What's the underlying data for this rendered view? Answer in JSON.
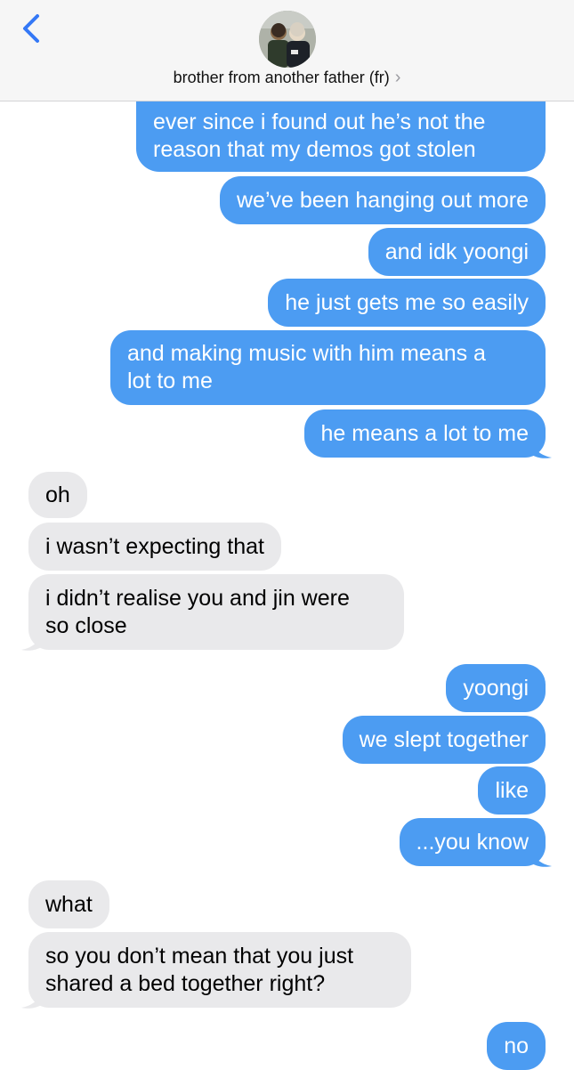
{
  "header": {
    "contact_name": "brother from another father (fr)",
    "chevron": "›",
    "back_icon": "chevron-left-icon",
    "avatar": "contact-avatar-photo"
  },
  "colors": {
    "sent_bubble": "#4c9cf2",
    "received_bubble": "#e9e9eb",
    "ios_blue": "#3478f6"
  },
  "messages": [
    {
      "from": "me",
      "lines": [
        "ever since i found out he’s not the",
        "reason that my demos got stolen"
      ]
    },
    {
      "from": "me",
      "lines": [
        "we’ve been hanging out more"
      ]
    },
    {
      "from": "me",
      "lines": [
        "and idk yoongi"
      ]
    },
    {
      "from": "me",
      "lines": [
        "he just gets me so easily"
      ]
    },
    {
      "from": "me",
      "lines": [
        "and making music with him means a",
        "lot to me"
      ]
    },
    {
      "from": "me",
      "lines": [
        "he means a lot to me"
      ]
    },
    {
      "from": "them",
      "lines": [
        "oh"
      ]
    },
    {
      "from": "them",
      "lines": [
        "i wasn’t expecting that"
      ]
    },
    {
      "from": "them",
      "lines": [
        "i didn’t realise you and jin were",
        "so close"
      ]
    },
    {
      "from": "me",
      "lines": [
        "yoongi"
      ]
    },
    {
      "from": "me",
      "lines": [
        "we slept together"
      ]
    },
    {
      "from": "me",
      "lines": [
        "like"
      ]
    },
    {
      "from": "me",
      "lines": [
        "...you know"
      ]
    },
    {
      "from": "them",
      "lines": [
        "what"
      ]
    },
    {
      "from": "them",
      "lines": [
        "so you don’t mean that you just",
        "shared a bed together right?"
      ]
    },
    {
      "from": "me",
      "lines": [
        "no"
      ]
    }
  ]
}
